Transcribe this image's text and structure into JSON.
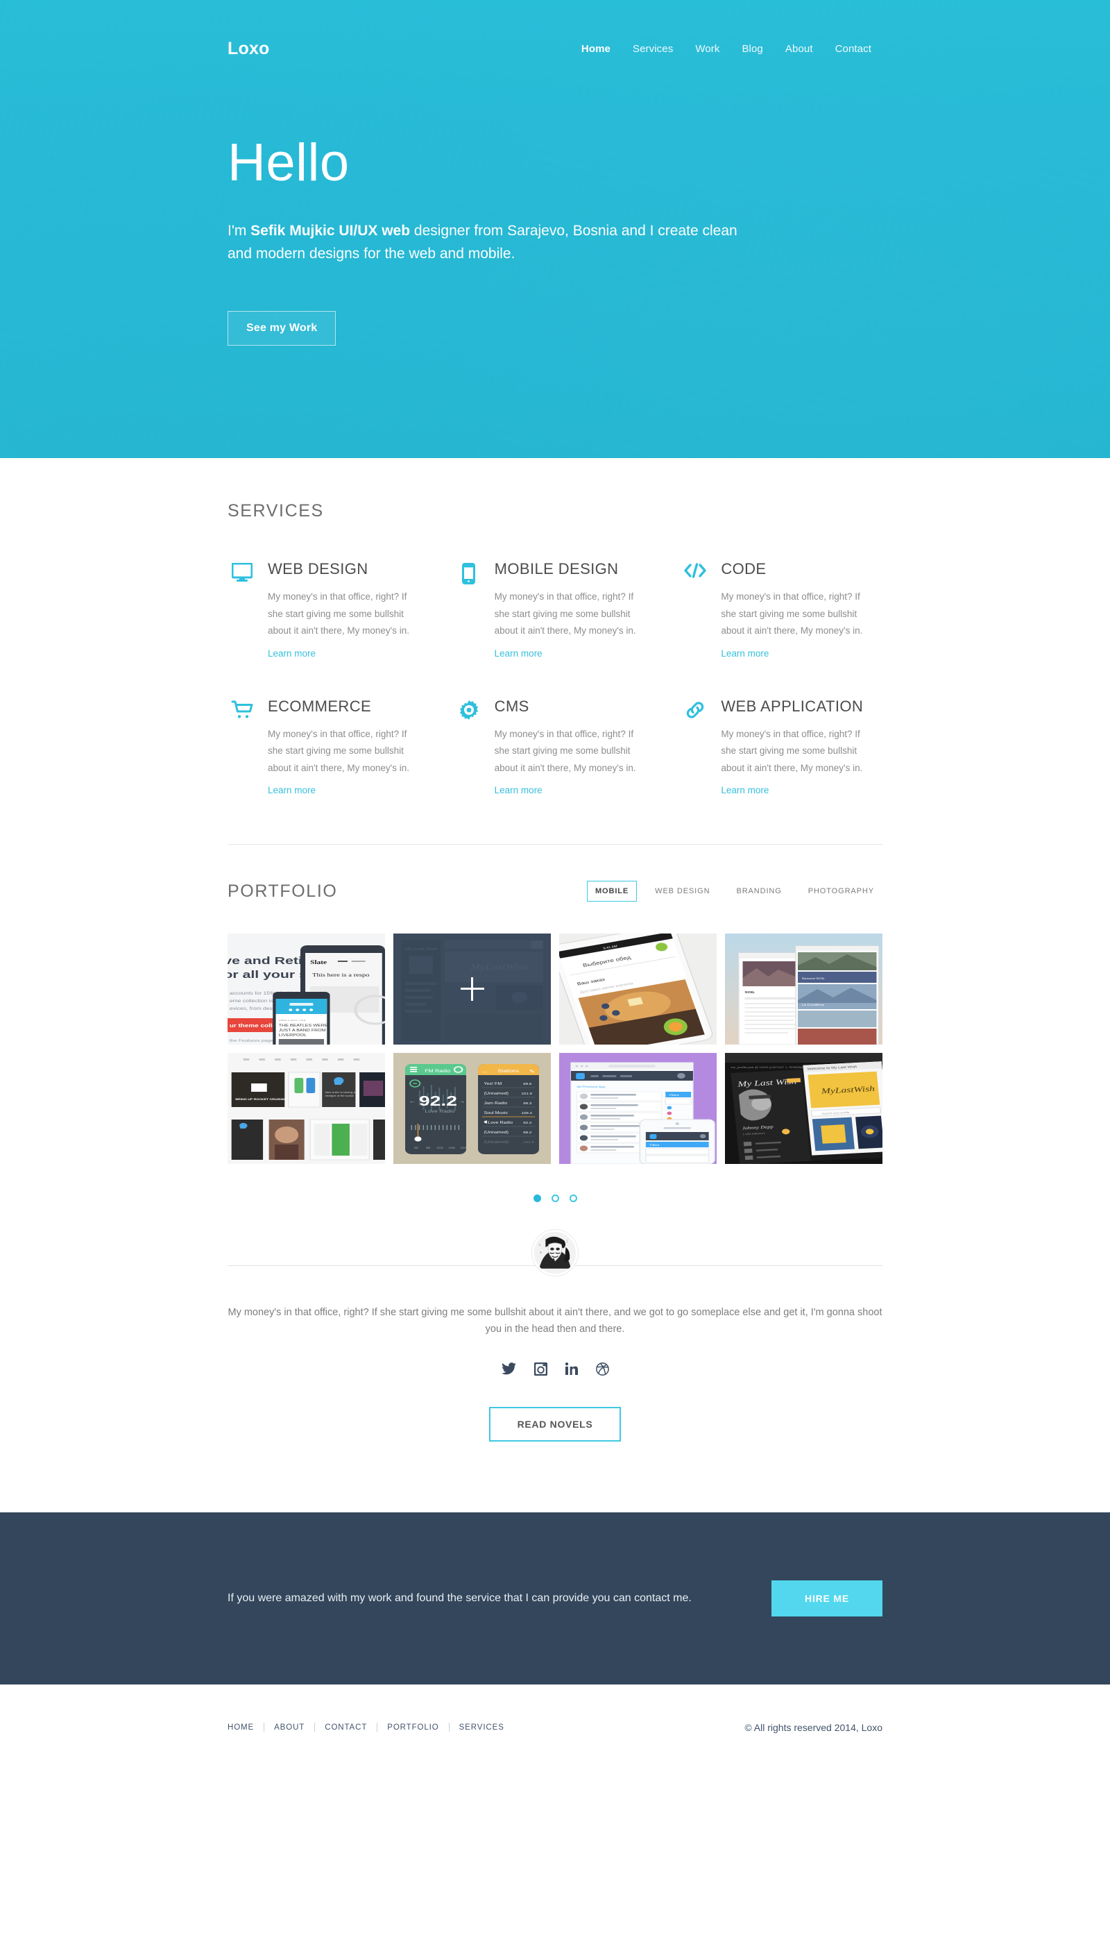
{
  "brand": {
    "logo": "Loxo",
    "accent": "#2ab9d8",
    "dark": "#33465c"
  },
  "nav": {
    "items": [
      {
        "label": "Home",
        "active": true
      },
      {
        "label": "Services",
        "active": false
      },
      {
        "label": "Work",
        "active": false
      },
      {
        "label": "Blog",
        "active": false
      },
      {
        "label": "About",
        "active": false
      },
      {
        "label": "Contact",
        "active": false
      }
    ]
  },
  "hero": {
    "heading": "Hello",
    "intro_prefix": "I'm ",
    "intro_bold": "Sefik Mujkic UI/UX web",
    "intro_suffix": " designer from Sarajevo, Bosnia and I create clean and modern designs for the web and mobile.",
    "cta_label": "See my Work"
  },
  "services": {
    "title": "SERVICES",
    "link_label": "Learn more",
    "body": "My money's in that office, right? If she start giving me some bullshit about it ain't there, My money's in.",
    "items": [
      {
        "title": "WEB DESIGN",
        "icon": "monitor-icon"
      },
      {
        "title": "MOBILE DESIGN",
        "icon": "phone-icon"
      },
      {
        "title": "CODE",
        "icon": "code-icon"
      },
      {
        "title": "ECOMMERCE",
        "icon": "cart-icon"
      },
      {
        "title": "CMS",
        "icon": "gear-icon"
      },
      {
        "title": "WEB APPLICATION",
        "icon": "link-icon"
      }
    ]
  },
  "portfolio": {
    "title": "PORTFOLIO",
    "filters": [
      {
        "label": "MOBILE",
        "active": true
      },
      {
        "label": "WEB DESIGN",
        "active": false
      },
      {
        "label": "BRANDING",
        "active": false
      },
      {
        "label": "PHOTOGRAPHY",
        "active": false
      }
    ],
    "items": [
      {
        "name": "responsive-retina-theme",
        "hover": false
      },
      {
        "name": "my-last-wish-dashboard",
        "hover": true
      },
      {
        "name": "food-app-phone-mockup",
        "hover": false
      },
      {
        "name": "travel-blog-screens",
        "hover": false
      },
      {
        "name": "mobile-cards-grid",
        "hover": false
      },
      {
        "name": "fm-radio-app",
        "hover": false
      },
      {
        "name": "hiring-app-purple",
        "hover": false
      },
      {
        "name": "my-last-wish-desktop",
        "hover": false
      }
    ],
    "dots": [
      {
        "active": true
      },
      {
        "active": false
      },
      {
        "active": false
      }
    ]
  },
  "testimonial": {
    "avatar_alt": "guy-fawkes-mask-avatar",
    "quote": "My money's in that office, right? If she start giving me some bullshit about it ain't there, and we got to go someplace else and get it, I'm gonna shoot you in the head then and there.",
    "socials": [
      {
        "name": "twitter-icon"
      },
      {
        "name": "instagram-icon"
      },
      {
        "name": "linkedin-icon"
      },
      {
        "name": "dribbble-icon"
      }
    ],
    "button_label": "READ NOVELS"
  },
  "cta": {
    "text": "If you were amazed with my work and found the service that I can provide you can contact me.",
    "button_label": "HIRE ME"
  },
  "footer": {
    "links": [
      "HOME",
      "ABOUT",
      "CONTACT",
      "PORTFOLIO",
      "SERVICES"
    ],
    "copyright": "© All rights reserved 2014, Loxo"
  }
}
